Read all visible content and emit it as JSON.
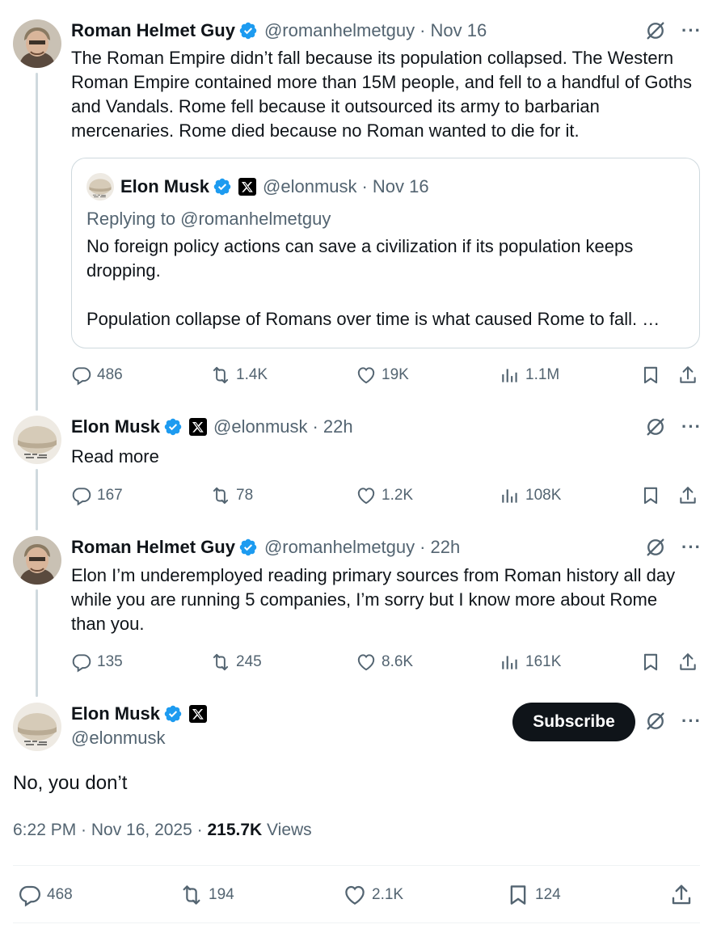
{
  "tweets": [
    {
      "name": "Roman Helmet Guy",
      "handle": "@romanhelmetguy",
      "time": "Nov 16",
      "text": "The Roman Empire didn’t fall because its population collapsed. The Western Roman Empire contained more than 15M people, and fell to a handful of Goths and Vandals. Rome fell because it outsourced its army to barbarian mercenaries. Rome died because no Roman wanted to die for it.",
      "quote": {
        "name": "Elon Musk",
        "handle": "@elonmusk",
        "time": "Nov 16",
        "replying": "Replying to @romanhelmetguy",
        "text": "No foreign policy actions can save a civilization if its population keeps dropping.\n\nPopulation collapse of Romans over time is what caused Rome to fall. …"
      },
      "stats": {
        "replies": "486",
        "reposts": "1.4K",
        "likes": "19K",
        "views": "1.1M"
      }
    },
    {
      "name": "Elon Musk",
      "handle": "@elonmusk",
      "time": "22h",
      "text": "Read more",
      "stats": {
        "replies": "167",
        "reposts": "78",
        "likes": "1.2K",
        "views": "108K"
      }
    },
    {
      "name": "Roman Helmet Guy",
      "handle": "@romanhelmetguy",
      "time": "22h",
      "text": "Elon I’m underemployed reading primary sources from Roman history all day while you are running 5 companies, I’m sorry but I know more about Rome than you.",
      "stats": {
        "replies": "135",
        "reposts": "245",
        "likes": "8.6K",
        "views": "161K"
      }
    }
  ],
  "main": {
    "name": "Elon Musk",
    "handle": "@elonmusk",
    "subscribe_label": "Subscribe",
    "text": "No, you don’t",
    "timestamp": "6:22 PM · Nov 16, 2025 · ",
    "views_count": "215.7K",
    "views_label": " Views",
    "stats": {
      "replies": "468",
      "reposts": "194",
      "likes": "2.1K",
      "bookmarks": "124"
    }
  },
  "separator": "·",
  "more_label": "···",
  "colors": {
    "text": "#0f1419",
    "secondary": "#536471",
    "verified": "#1d9bf0",
    "border": "#cfd9de"
  }
}
